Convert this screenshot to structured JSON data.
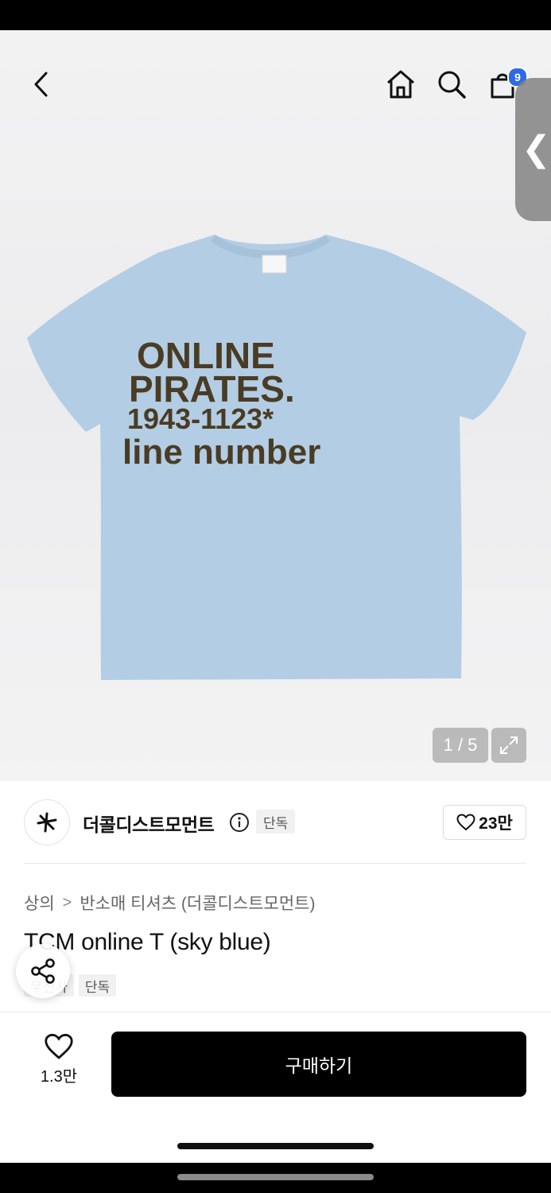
{
  "nav": {
    "cart_badge": "9",
    "icons": [
      "back-icon",
      "home-icon",
      "search-icon",
      "cart-icon"
    ]
  },
  "side_tab": {
    "glyph": "❮"
  },
  "gallery": {
    "counter": "1 / 5",
    "shirt_color": "#b3cde4",
    "print_color": "#4a3c24",
    "print_lines": [
      "ONLINE",
      "PIRATES.",
      "1943-1123*",
      "line number"
    ]
  },
  "brand": {
    "name": "더콜디스트모먼트",
    "exclusive": "단독",
    "like_count": "23만"
  },
  "breadcrumb": {
    "category": "상의",
    "separator": ">",
    "subcategory": "반소매 티셔츠 (더콜디스트모먼트)"
  },
  "product": {
    "title": "TCM online T (sky blue)",
    "tags": [
      "무신사",
      "단독"
    ]
  },
  "bottom_bar": {
    "wish_count": "1.3만",
    "buy_label": "구매하기"
  }
}
